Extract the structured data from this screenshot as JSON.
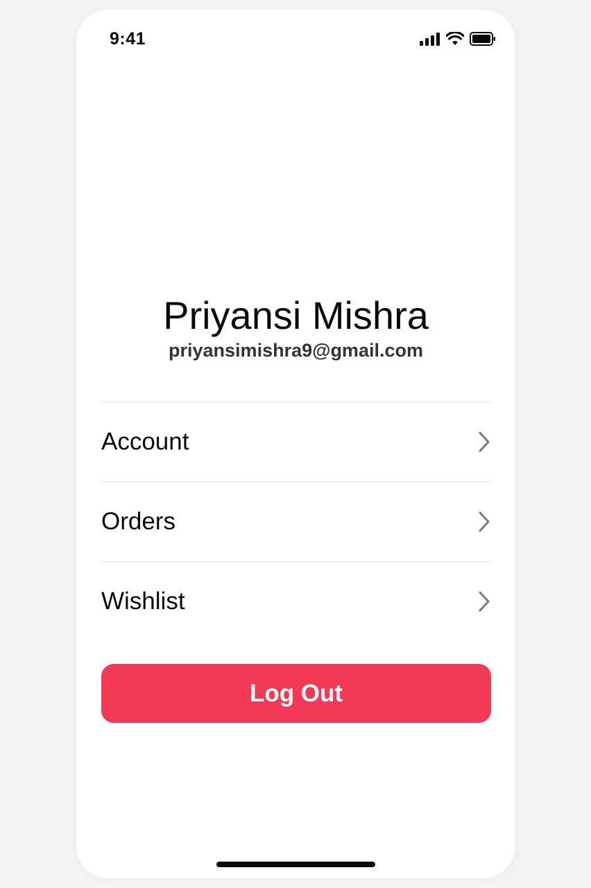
{
  "status_bar": {
    "time": "9:41",
    "icons": [
      "signal-icon",
      "wifi-icon",
      "battery-icon"
    ]
  },
  "profile": {
    "name": "Priyansi Mishra",
    "email": "priyansimishra9@gmail.com"
  },
  "menu": {
    "items": [
      {
        "label": "Account",
        "icon": "chevron-right-icon"
      },
      {
        "label": "Orders",
        "icon": "chevron-right-icon"
      },
      {
        "label": "Wishlist",
        "icon": "chevron-right-icon"
      }
    ]
  },
  "actions": {
    "logout_label": "Log Out"
  },
  "colors": {
    "accent": "#f23a57",
    "text": "#0a0a0a",
    "background": "#ffffff"
  }
}
